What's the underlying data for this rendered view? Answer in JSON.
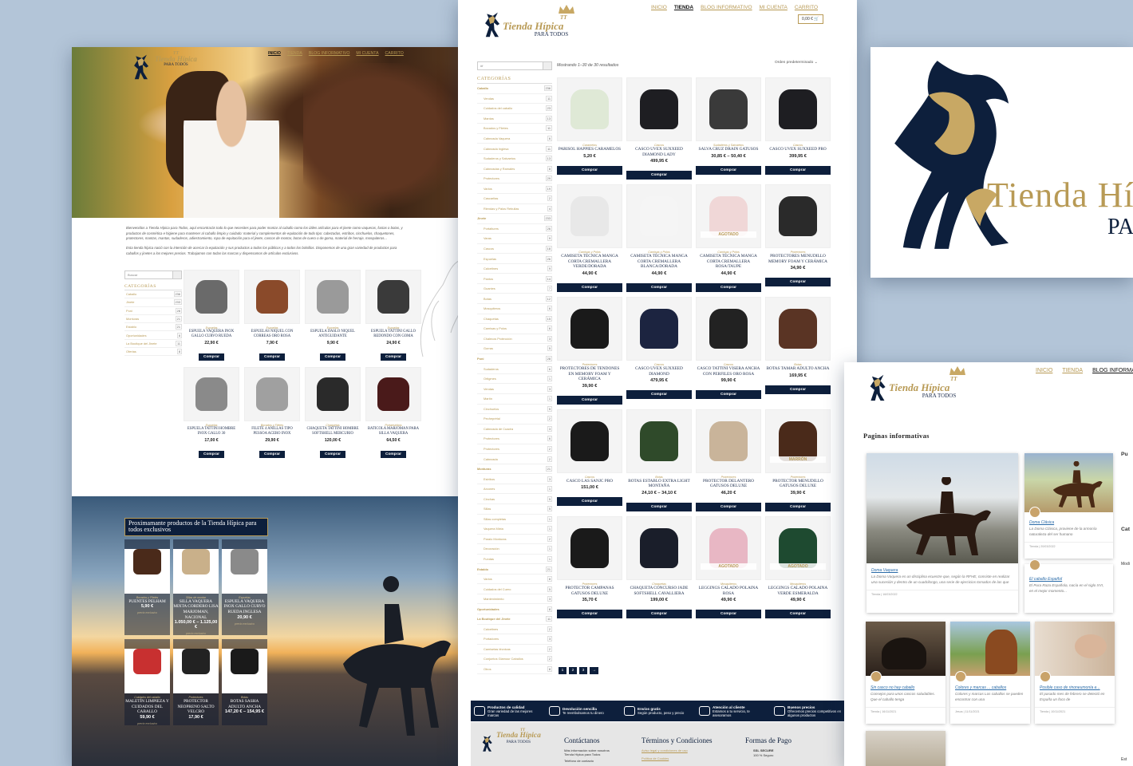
{
  "colors": {
    "navy": "#0d1f3c",
    "gold": "#b89a55",
    "background": "#b3c5d8"
  },
  "logo": {
    "monogram": "TT",
    "title": "Tienda Hípica",
    "subtitle": "PARA TODOS"
  },
  "nav": [
    "INICIO",
    "TIENDA",
    "BLOG INFORMATIVO",
    "MI CUENTA",
    "CARRITO"
  ],
  "home": {
    "intro1": "Bienvenidos a Tienda Hípica para Todos, aquí encontrarás todo lo que necesites para poder montar al caballo como los útiles artículos para el jinete como vaqueras, fustas o botas, y productos de cosmética e higiene para mantener al caballo limpio y cuidado: material y complementos de equitación de todo tipo: cabezadas, estribos, cinchuelos, chaquetones, protectores, mantas, mantas, sudaderos, adiestramiento, ropa de equitación para el jinete, cascos de montar, botas de cuero o de goma, material de herraje, mosquiteros...",
    "intro2": "Esta tienda hípica nació con la intención de acercar la equitación y sus productos a todos los públicos y a todos los bolsillos. Disponemos de una gran variedad de productos para caballos y jinetes a los mejores precios. Trabajamos con todas las marcas y dispensamos de artículos exclusivos.",
    "search": "Buscar",
    "categories_title": "CATEGORÍAS",
    "categories": [
      {
        "name": "Caballo",
        "count": "236"
      },
      {
        "name": "Jinete",
        "count": "233"
      },
      {
        "name": "Poni",
        "count": "28"
      },
      {
        "name": "Monturas",
        "count": "21"
      },
      {
        "name": "Establo",
        "count": "21"
      },
      {
        "name": "Oportunidades",
        "count": "8"
      },
      {
        "name": "La Boutique del Jinete",
        "count": "11"
      },
      {
        "name": "Ofertas",
        "count": "8"
      }
    ],
    "products": [
      {
        "cat": "Espuelas",
        "name": "Espuela vaquera inox gallo curvo rueda",
        "price": "22,90 €"
      },
      {
        "cat": "Espuelas",
        "name": "Espuelas niquel con correas oro rosa",
        "price": "7,90 €"
      },
      {
        "cat": "Espuelas",
        "name": "Espuela Daslo niquel antiguidante",
        "price": "9,90 €"
      },
      {
        "cat": "Espuelas",
        "name": "Espuela tattini gallo redondo con goma",
        "price": "24,90 €"
      },
      {
        "cat": "Espuelas",
        "name": "Espuela tattini hombre inox gallo 30",
        "price": "17,00 €"
      },
      {
        "cat": "Bocados y Filetes",
        "name": "Filete 4 anillas tipo pessoa acero inox",
        "price": "29,90 €"
      },
      {
        "cat": "Chaquetas",
        "name": "Chaqueta Tattini hombre softshell mercurio",
        "price": "120,00 €"
      },
      {
        "cat": "Portaestribos",
        "name": "Baticola Marjoman para silla vaquera",
        "price": "64,50 €"
      }
    ],
    "buy_label": "Comprar",
    "exclusive_title": "Proximamante productos de la Tienda Hípica para todos exclusivos",
    "exclusive": [
      {
        "cat": "Bocados y Filetes",
        "name": "Puentes pelham",
        "price": "5,90 €",
        "note": "precio exclusivo"
      },
      {
        "cat": "Sillas de montar",
        "name": "Silla vaquera mixta cordero lisa Marjoman, Nacional",
        "price": "1.050,00 € – 1.125,00 €",
        "note": "precio exclusivo"
      },
      {
        "cat": "Espuelas",
        "name": "Espuela vaquera inox gallo curvo rueda inglesa",
        "price": "20,90 €",
        "note": "precio exclusivo"
      },
      {
        "cat": "Cuidados del caballo",
        "name": "Maletín limpieza y cuidados del caballo",
        "price": "59,90 €",
        "note": "precio exclusivo"
      },
      {
        "cat": "Protectores",
        "name": "Protector neopreno salto velcro",
        "price": "17,90 €",
        "note": ""
      },
      {
        "cat": "Botas",
        "name": "Botas Sasha adulto ancha",
        "price": "147,20 € – 154,95 €",
        "note": ""
      }
    ]
  },
  "shop": {
    "search": "#f",
    "results": "Mostrando 1–30 de 30 resultados",
    "order": "Orden predeterminado",
    "cart": "0,00 €",
    "categories_title": "CATEGORÍAS",
    "sidebar": [
      {
        "name": "Caballo",
        "count": "236",
        "top": true
      },
      {
        "name": "Vendas",
        "count": "11"
      },
      {
        "name": "Cuidados del caballo",
        "count": "23"
      },
      {
        "name": "Mantas",
        "count": "13"
      },
      {
        "name": "Bocados y Filetes",
        "count": "11"
      },
      {
        "name": "Cabezada Vaquera",
        "count": "6"
      },
      {
        "name": "Cabezada Inglesa",
        "count": "11"
      },
      {
        "name": "Sudaderos y Salvaetos",
        "count": "13"
      },
      {
        "name": "Cabezadas y Ramales",
        "count": "8"
      },
      {
        "name": "Protectores",
        "count": "29"
      },
      {
        "name": "Varios",
        "count": "19"
      },
      {
        "name": "Cascaritas",
        "count": "2"
      },
      {
        "name": "Riendas y Palos Rebullas",
        "count": "4"
      },
      {
        "name": "Jinete",
        "count": "233",
        "top": true
      },
      {
        "name": "Portaltures",
        "count": "26"
      },
      {
        "name": "Varas",
        "count": "9"
      },
      {
        "name": "Cascos",
        "count": "18"
      },
      {
        "name": "Espuelas",
        "count": "26"
      },
      {
        "name": "Calcetines",
        "count": "9"
      },
      {
        "name": "Pantos",
        "count": "14"
      },
      {
        "name": "Guantes",
        "count": "7"
      },
      {
        "name": "Botas",
        "count": "12"
      },
      {
        "name": "Mosquiteros",
        "count": "6"
      },
      {
        "name": "Chaquetas",
        "count": "15"
      },
      {
        "name": "Camisas y Polos",
        "count": "6"
      },
      {
        "name": "Chalecos Protección",
        "count": "3"
      },
      {
        "name": "Gorras",
        "count": "5"
      },
      {
        "name": "Poni",
        "count": "28",
        "top": true
      },
      {
        "name": "Sudaderos",
        "count": "6"
      },
      {
        "name": "Ortigmes",
        "count": "1"
      },
      {
        "name": "Vendas",
        "count": "3"
      },
      {
        "name": "Martín",
        "count": "1"
      },
      {
        "name": "Cinchuelos",
        "count": "5"
      },
      {
        "name": "Pecheprétal",
        "count": "2"
      },
      {
        "name": "Cabezada de Cuadra",
        "count": "3"
      },
      {
        "name": "Protectores",
        "count": "6"
      },
      {
        "name": "Protectores",
        "count": "2"
      },
      {
        "name": "Cabezada",
        "count": "2"
      },
      {
        "name": "Monturas",
        "count": "21",
        "top": true
      },
      {
        "name": "Estribos",
        "count": "3"
      },
      {
        "name": "Arcones",
        "count": "1"
      },
      {
        "name": "Cinchas",
        "count": "5"
      },
      {
        "name": "Sillas",
        "count": "5"
      },
      {
        "name": "Sillas completas",
        "count": "1"
      },
      {
        "name": "Vaquera Mixta",
        "count": "1"
      },
      {
        "name": "Paralo Monturas",
        "count": "2"
      },
      {
        "name": "Decoración",
        "count": "1"
      },
      {
        "name": "Fundas",
        "count": "1"
      },
      {
        "name": "Establo",
        "count": "21",
        "top": true
      },
      {
        "name": "Varios",
        "count": "8"
      },
      {
        "name": "Cuidados del Cuero",
        "count": "5"
      },
      {
        "name": "Mantenimiento",
        "count": "3"
      },
      {
        "name": "Oportunidades",
        "count": "8",
        "top": true
      },
      {
        "name": "La Boutique del Jinete",
        "count": "11",
        "top": true
      },
      {
        "name": "Calcetines",
        "count": "2"
      },
      {
        "name": "Portadores",
        "count": "3"
      },
      {
        "name": "Camisetas técnicas",
        "count": "2"
      },
      {
        "name": "Conjuntos Glamour Caballos",
        "count": "2"
      },
      {
        "name": "Otros",
        "count": "8"
      }
    ],
    "products": [
      {
        "cat": "Caramelos",
        "name": "Parisol happies caramelos",
        "price": "5,20 €"
      },
      {
        "cat": "Cascos",
        "name": "Casco Uvex suxxeed diamond lady",
        "price": "499,95 €"
      },
      {
        "cat": "Sudaderos y Salvaetos",
        "name": "Salva cruz drain gatusos",
        "price": "30,85 € – 50,40 €"
      },
      {
        "cat": "Cascos",
        "name": "Casco Uvex suxxeed pro",
        "price": "399,95 €"
      },
      {
        "cat": "Camisas y Polos",
        "name": "Camiseta técnica manga corta cremallera verde/dorada",
        "price": "44,90 €"
      },
      {
        "cat": "Camisas y Polos",
        "name": "Camiseta técnica manga corta cremallera blanca/dorada",
        "price": "44,90 €"
      },
      {
        "cat": "Camisas y Polos",
        "name": "Camiseta técnica manga corta cremallera rosa/taupe",
        "price": "44,90 €",
        "badge": "AGOTADO"
      },
      {
        "cat": "Protectores",
        "name": "Protectores menudillo memory foam y cerámica",
        "price": "34,90 €"
      },
      {
        "cat": "Protectores",
        "name": "Protectores de tendones en memory foam y cerámica",
        "price": "39,90 €"
      },
      {
        "cat": "Cascos",
        "name": "Casco Uvex suxxeed diamond",
        "price": "479,95 €"
      },
      {
        "cat": "Cascos",
        "name": "Casco Tattini visera ancha con perfiles oro rosa",
        "price": "99,90 €"
      },
      {
        "cat": "Botas",
        "name": "Botas Tamar adulto ancha",
        "price": "169,95 €"
      },
      {
        "cat": "Cascos",
        "name": "Casco LAS Sanjc pro",
        "price": "151,00 €"
      },
      {
        "cat": "Botas",
        "name": "Botas establo extra light montaña",
        "price": "24,10 € – 34,10 €"
      },
      {
        "cat": "Protectores",
        "name": "Protector delantero gatusos deluxe",
        "price": "46,20 €"
      },
      {
        "cat": "Protectores",
        "name": "Protector menudillo gatusos deluxe",
        "price": "39,90 €",
        "badge": "MARRÓN"
      },
      {
        "cat": "Protectores",
        "name": "Protector campanas gatusos deluxe",
        "price": "35,70 €"
      },
      {
        "cat": "Chaquetas",
        "name": "Chaqueta concurso Jade softshell cavalliera",
        "price": "199,00 €"
      },
      {
        "cat": "Mosquiteros",
        "name": "Leggings calado polaina rosa",
        "price": "49,90 €",
        "badge": "AGOTADO"
      },
      {
        "cat": "Mosquiteros",
        "name": "Leggings calado polaina verde esmeralda",
        "price": "49,90 €",
        "badge": "AGOTADO"
      }
    ],
    "buy_label": "Comprar",
    "pages": [
      "1",
      "2",
      "3",
      "→"
    ],
    "features": [
      {
        "title": "Productos de calidad",
        "text": "Gran variedad de las mejores marcas"
      },
      {
        "title": "Devolución sencilla",
        "text": "Te reembolsamos tu dinero"
      },
      {
        "title": "Envíos gratis",
        "text": "Según producto, peso y precio"
      },
      {
        "title": "Atención al cliente",
        "text": "Estamos a tu servicio, te asesoramos"
      },
      {
        "title": "Buenos precios",
        "text": "Ofrecemos precios competitivos en algunos productos"
      }
    ],
    "footer": {
      "contact_title": "Contáctanos",
      "contact_text": "Más información sobre nosotros Tienda Hípica para Todos",
      "phone": "Teléfono de contacto",
      "terms_title": "Términos y Condiciones",
      "terms1": "Aviso legal y condiciones de uso",
      "terms2": "Política de Cookies",
      "pay_title": "Formas de Pago",
      "pay1": "SSL SECURE",
      "pay2": "100 % Seguro"
    }
  },
  "blog": {
    "title": "Paginas informativas",
    "posts": [
      {
        "title": "Doma Vaquera",
        "excerpt": "La Doma Vaquera es un disciplina ecuestre que, según la RFHE, consiste en realizar una sucesión y dentro de un cuadrilongo, una serie de ejercicios tomados de las que",
        "meta": "Tienda | 16/03/2022"
      },
      {
        "title": "Doma Clásica",
        "excerpt": "La Doma Clásica, proviene de la armonía naturaleza del ser humano",
        "meta": "Tienda | 20/03/2022"
      },
      {
        "title": "El caballo Español",
        "excerpt": "El Pura Raza Española, nacía en el siglo XVI, en el mejor momento...",
        "meta": "Tienda | 11/12/2021"
      },
      {
        "title": "Sin casco no hay caballo",
        "excerpt": "Consejos para unos cascos saludables. Que el caballo tenga",
        "meta": "Tienda | 16/11/2021"
      },
      {
        "title": "Colores y marcas ... caballos",
        "excerpt": "Colores y marcas Los caballos se pueden encontrar con una",
        "meta": "Jesus | 11/11/2021"
      },
      {
        "title": "Posible caso de rinoneumonía e...",
        "excerpt": "El pasado mes de febrero se detectó en España un foco de",
        "meta": "Tienda | 10/11/2021"
      }
    ],
    "side_items": [
      "Pu",
      "Cat",
      "Modi",
      "Est"
    ]
  }
}
